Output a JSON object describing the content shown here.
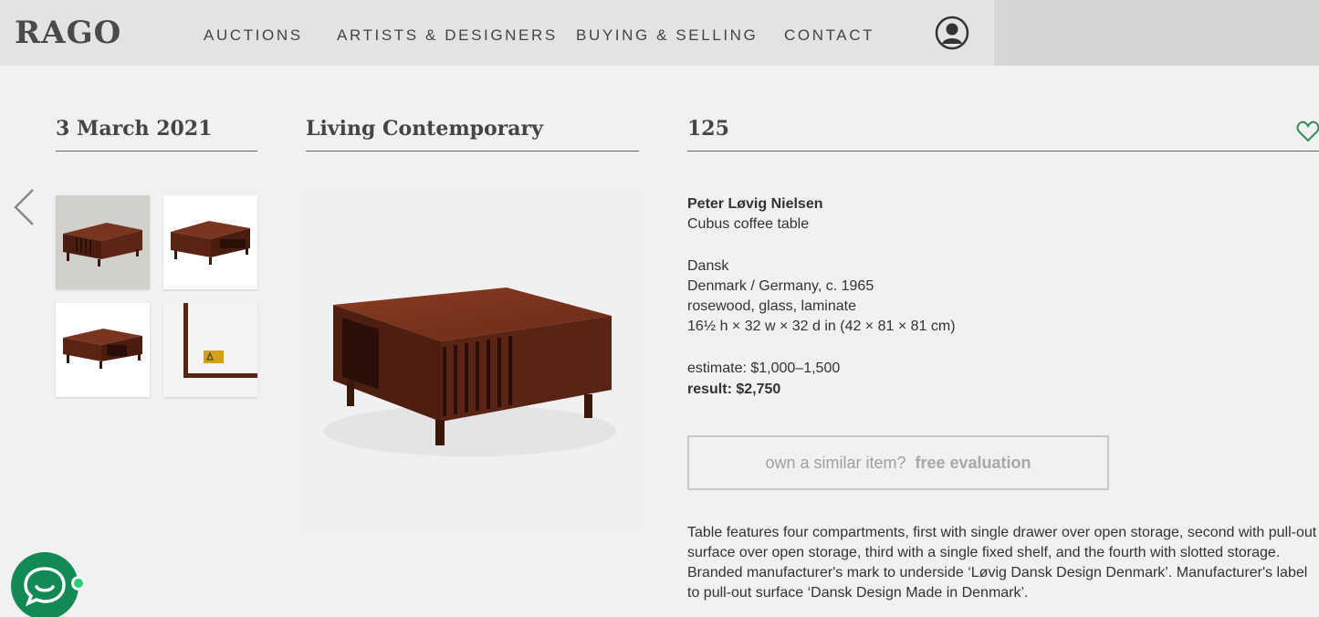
{
  "header": {
    "logo": "RAGO",
    "nav": [
      "AUCTIONS",
      "ARTISTS & DESIGNERS",
      "BUYING & SELLING",
      "CONTACT"
    ]
  },
  "auction": {
    "date": "3 March 2021",
    "name": "Living Contemporary",
    "lot": "125"
  },
  "lot": {
    "designer": "Peter Løvig Nielsen",
    "title": "Cubus coffee table",
    "manufacturer": "Dansk",
    "origin": "Denmark / Germany, c. 1965",
    "materials": "rosewood, glass, laminate",
    "dimensions": "16½ h × 32 w × 32 d in (42 × 81 × 81 cm)",
    "estimate": "estimate: $1,000–1,500",
    "result": "result: $2,750",
    "description": "Table features four compartments, first with single drawer over open storage, second with pull-out surface over open storage, third with a single fixed shelf, and the fourth with slotted storage. Branded manufacturer's mark to underside ‘Løvig Dansk Design Denmark’. Manufacturer's label to pull-out surface ‘Dansk Design Made in Denmark’."
  },
  "evaluation": {
    "prompt": "own a similar item?",
    "action": "free evaluation"
  },
  "colors": {
    "accent_green": "#118a55",
    "wood": "#5a2414"
  }
}
